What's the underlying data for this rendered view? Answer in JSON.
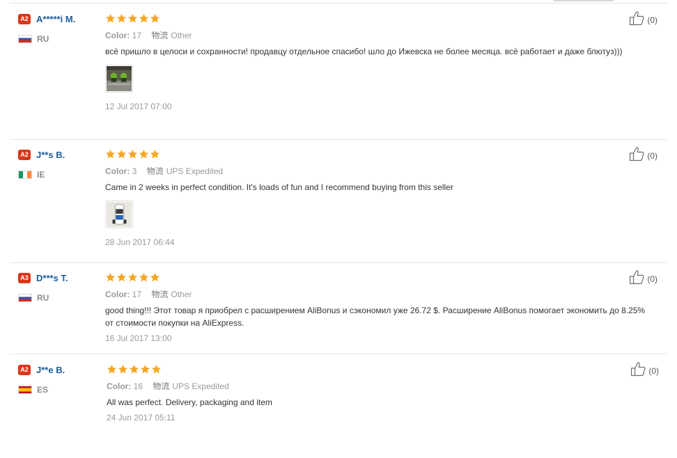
{
  "reviews": [
    {
      "level": "A2",
      "name": "A*****i M.",
      "country": "RU",
      "flag": "ru",
      "rating": 5,
      "color_label": "Color:",
      "color_value": "17",
      "shipping_label": "物流",
      "shipping_value": "Other",
      "text": "всё пришло в целоси и сохранности! продавцу отдельное спасибо! шло до Ижевска не более месяца. всё работает и даже блютуз)))",
      "has_photo": true,
      "photo_icon": "product-photo-thumbnail",
      "date": "12 Jul 2017 07:00",
      "helpful_count": "(0)"
    },
    {
      "level": "A2",
      "name": "J**s B.",
      "country": "IE",
      "flag": "ie",
      "rating": 5,
      "color_label": "Color:",
      "color_value": "3",
      "shipping_label": "物流",
      "shipping_value": "UPS Expedited",
      "text": "Came in 2 weeks in perfect condition. It's loads of fun and I recommend buying from this seller",
      "has_photo": true,
      "photo_icon": "product-photo-thumbnail",
      "date": "28 Jun 2017 06:44",
      "helpful_count": "(0)"
    },
    {
      "level": "A3",
      "name": "D***s T.",
      "country": "RU",
      "flag": "ru",
      "rating": 5,
      "color_label": "Color:",
      "color_value": "17",
      "shipping_label": "物流",
      "shipping_value": "Other",
      "text": "good thing!!! Этот товар я приобрел с расширением AliBonus и сэкономил уже 26.72 $. Расширение AliBonus помогает экономить до 8.25% от стоимости покупки на AliExpress.",
      "has_photo": false,
      "date": "16 Jul 2017 13:00",
      "helpful_count": "(0)"
    },
    {
      "level": "A2",
      "name": "J**e B.",
      "country": "ES",
      "flag": "es",
      "rating": 5,
      "color_label": "Color:",
      "color_value": "16",
      "shipping_label": "物流",
      "shipping_value": "UPS Expedited",
      "text": "All was perfect. Delivery, packaging and item",
      "has_photo": false,
      "date": "24 Jun 2017 05:11",
      "helpful_count": "(0)"
    }
  ],
  "colors": {
    "level_badge": "#d9361a",
    "username": "#1a5b9c",
    "star": "#f5a623",
    "divider": "#e6e6e6"
  },
  "icons": {
    "star": "star-icon",
    "thumbs_up": "thumbs-up-icon",
    "flag_ru": "russia-flag-icon",
    "flag_ie": "ireland-flag-icon",
    "flag_es": "spain-flag-icon"
  }
}
